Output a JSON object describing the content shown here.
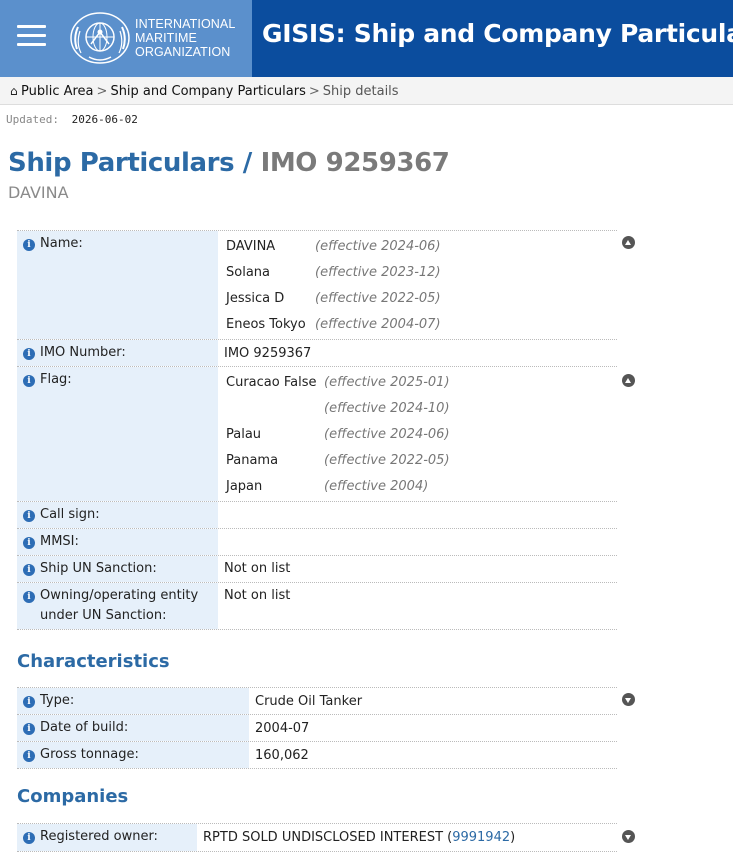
{
  "header": {
    "org_lines": [
      "INTERNATIONAL",
      "MARITIME",
      "ORGANIZATION"
    ],
    "title": "GISIS: Ship and Company Particulars",
    "bg_color": "#0b4d9e",
    "logo_bg_color": "#5b90cc"
  },
  "breadcrumb": {
    "items": [
      "Public Area",
      "Ship and Company Particulars"
    ],
    "current": "Ship details",
    "separator": ">"
  },
  "updated": {
    "label": "Updated:",
    "value": "2026-06-02"
  },
  "page": {
    "title_part1": "Ship Particulars /",
    "title_part2": "IMO 9259367",
    "subtitle": "DAVINA"
  },
  "particulars": {
    "name_label": "Name:",
    "names": [
      {
        "name": "DAVINA",
        "effective": "(effective 2024-06)"
      },
      {
        "name": "Solana",
        "effective": "(effective 2023-12)"
      },
      {
        "name": "Jessica D",
        "effective": "(effective 2022-05)"
      },
      {
        "name": "Eneos Tokyo",
        "effective": "(effective 2004-07)"
      }
    ],
    "imo_label": "IMO Number:",
    "imo_value": "IMO 9259367",
    "flag_label": "Flag:",
    "flags": [
      {
        "name": "Curacao False",
        "effective": "(effective 2025-01)"
      },
      {
        "name": "",
        "effective": "(effective 2024-10)"
      },
      {
        "name": "Palau",
        "effective": "(effective 2024-06)"
      },
      {
        "name": "Panama",
        "effective": "(effective 2022-05)"
      },
      {
        "name": "Japan",
        "effective": "(effective 2004)"
      }
    ],
    "callsign_label": "Call sign:",
    "callsign_value": "",
    "mmsi_label": "MMSI:",
    "mmsi_value": "",
    "un_sanction_label": "Ship UN Sanction:",
    "un_sanction_value": "Not on list",
    "owning_label": "Owning/operating entity under UN Sanction:",
    "owning_value": "Not on list"
  },
  "characteristics": {
    "title": "Characteristics",
    "type_label": "Type:",
    "type_value": "Crude Oil Tanker",
    "build_label": "Date of build:",
    "build_value": "2004-07",
    "gt_label": "Gross tonnage:",
    "gt_value": "160,062"
  },
  "companies": {
    "title": "Companies",
    "owner_label": "Registered owner:",
    "owner_value": "RPTD SOLD UNDISCLOSED INTEREST (",
    "owner_id": "9991942",
    "owner_suffix": ")"
  },
  "icons": {
    "info": "info-icon",
    "collapse": "chevron-up-circle-icon",
    "expand": "chevron-down-circle-icon",
    "home": "home-icon",
    "menu": "hamburger-menu-icon",
    "logo": "imo-emblem-icon"
  },
  "colors": {
    "accent": "#2c6aa5",
    "label_bg": "#e6f0fa",
    "info_icon": "#2d6db5"
  }
}
